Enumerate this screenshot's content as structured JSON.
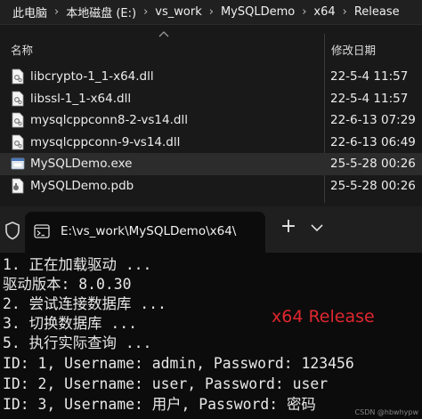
{
  "breadcrumb": {
    "items": [
      "此电脑",
      "本地磁盘 (E:)",
      "vs_work",
      "MySQLDemo",
      "x64",
      "Release"
    ],
    "separator": "›"
  },
  "columns": {
    "name": "名称",
    "date_modified": "修改日期"
  },
  "files": [
    {
      "name": "libcrypto-1_1-x64.dll",
      "date": "22-5-4 11:57",
      "icon": "dll-file-icon",
      "selected": false
    },
    {
      "name": "libssl-1_1-x64.dll",
      "date": "22-5-4 11:57",
      "icon": "dll-file-icon",
      "selected": false
    },
    {
      "name": "mysqlcppconn8-2-vs14.dll",
      "date": "22-6-13 07:29",
      "icon": "dll-file-icon",
      "selected": false
    },
    {
      "name": "mysqlcppconn-9-vs14.dll",
      "date": "22-6-13 06:49",
      "icon": "dll-file-icon",
      "selected": false
    },
    {
      "name": "MySQLDemo.exe",
      "date": "25-5-28 00:26",
      "icon": "exe-file-icon",
      "selected": true
    },
    {
      "name": "MySQLDemo.pdb",
      "date": "25-5-28 00:26",
      "icon": "pdb-file-icon",
      "selected": false
    }
  ],
  "terminal_tab": {
    "title": "E:\\vs_work\\MySQLDemo\\x64\\",
    "new_tab_label": "+"
  },
  "terminal": {
    "lines": [
      "1. 正在加载驱动 ...",
      "驱动版本: 8.0.30",
      "2. 尝试连接数据库 ...",
      "3. 切换数据库 ...",
      "5. 执行实际查询 ...",
      "ID: 1, Username: admin, Password: 123456",
      "ID: 2, Username: user, Password: user",
      "ID: 3, Username: 用户, Password: 密码"
    ],
    "overlay_label": "x64 Release",
    "watermark": "CSDN @hbwhypw"
  },
  "colors": {
    "selected_row": "#2c2c2c",
    "overlay_text": "#e0262e",
    "terminal_bg": "#0c0c0c"
  }
}
